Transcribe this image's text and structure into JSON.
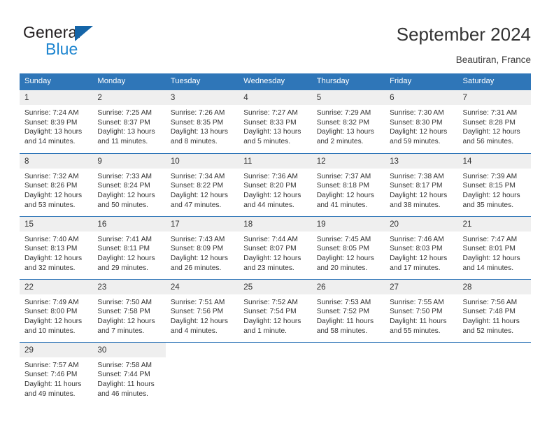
{
  "brand": {
    "word_one": "General",
    "word_two": "Blue",
    "triangle_color": "#1565a8",
    "blue_color": "#1f86d0"
  },
  "header": {
    "title": "September 2024",
    "location": "Beautiran, France"
  },
  "theme": {
    "header_blue": "#2f76b8",
    "daynum_band": "#efefef",
    "text": "#333333"
  },
  "labels": {
    "sunrise_prefix": "Sunrise:",
    "sunset_prefix": "Sunset:",
    "daylight_prefix": "Daylight:"
  },
  "columns": [
    "Sunday",
    "Monday",
    "Tuesday",
    "Wednesday",
    "Thursday",
    "Friday",
    "Saturday"
  ],
  "weeks": [
    [
      {
        "day": "1",
        "sunrise": "Sunrise: 7:24 AM",
        "sunset": "Sunset: 8:39 PM",
        "daylight_l1": "Daylight: 13 hours",
        "daylight_l2": "and 14 minutes."
      },
      {
        "day": "2",
        "sunrise": "Sunrise: 7:25 AM",
        "sunset": "Sunset: 8:37 PM",
        "daylight_l1": "Daylight: 13 hours",
        "daylight_l2": "and 11 minutes."
      },
      {
        "day": "3",
        "sunrise": "Sunrise: 7:26 AM",
        "sunset": "Sunset: 8:35 PM",
        "daylight_l1": "Daylight: 13 hours",
        "daylight_l2": "and 8 minutes."
      },
      {
        "day": "4",
        "sunrise": "Sunrise: 7:27 AM",
        "sunset": "Sunset: 8:33 PM",
        "daylight_l1": "Daylight: 13 hours",
        "daylight_l2": "and 5 minutes."
      },
      {
        "day": "5",
        "sunrise": "Sunrise: 7:29 AM",
        "sunset": "Sunset: 8:32 PM",
        "daylight_l1": "Daylight: 13 hours",
        "daylight_l2": "and 2 minutes."
      },
      {
        "day": "6",
        "sunrise": "Sunrise: 7:30 AM",
        "sunset": "Sunset: 8:30 PM",
        "daylight_l1": "Daylight: 12 hours",
        "daylight_l2": "and 59 minutes."
      },
      {
        "day": "7",
        "sunrise": "Sunrise: 7:31 AM",
        "sunset": "Sunset: 8:28 PM",
        "daylight_l1": "Daylight: 12 hours",
        "daylight_l2": "and 56 minutes."
      }
    ],
    [
      {
        "day": "8",
        "sunrise": "Sunrise: 7:32 AM",
        "sunset": "Sunset: 8:26 PM",
        "daylight_l1": "Daylight: 12 hours",
        "daylight_l2": "and 53 minutes."
      },
      {
        "day": "9",
        "sunrise": "Sunrise: 7:33 AM",
        "sunset": "Sunset: 8:24 PM",
        "daylight_l1": "Daylight: 12 hours",
        "daylight_l2": "and 50 minutes."
      },
      {
        "day": "10",
        "sunrise": "Sunrise: 7:34 AM",
        "sunset": "Sunset: 8:22 PM",
        "daylight_l1": "Daylight: 12 hours",
        "daylight_l2": "and 47 minutes."
      },
      {
        "day": "11",
        "sunrise": "Sunrise: 7:36 AM",
        "sunset": "Sunset: 8:20 PM",
        "daylight_l1": "Daylight: 12 hours",
        "daylight_l2": "and 44 minutes."
      },
      {
        "day": "12",
        "sunrise": "Sunrise: 7:37 AM",
        "sunset": "Sunset: 8:18 PM",
        "daylight_l1": "Daylight: 12 hours",
        "daylight_l2": "and 41 minutes."
      },
      {
        "day": "13",
        "sunrise": "Sunrise: 7:38 AM",
        "sunset": "Sunset: 8:17 PM",
        "daylight_l1": "Daylight: 12 hours",
        "daylight_l2": "and 38 minutes."
      },
      {
        "day": "14",
        "sunrise": "Sunrise: 7:39 AM",
        "sunset": "Sunset: 8:15 PM",
        "daylight_l1": "Daylight: 12 hours",
        "daylight_l2": "and 35 minutes."
      }
    ],
    [
      {
        "day": "15",
        "sunrise": "Sunrise: 7:40 AM",
        "sunset": "Sunset: 8:13 PM",
        "daylight_l1": "Daylight: 12 hours",
        "daylight_l2": "and 32 minutes."
      },
      {
        "day": "16",
        "sunrise": "Sunrise: 7:41 AM",
        "sunset": "Sunset: 8:11 PM",
        "daylight_l1": "Daylight: 12 hours",
        "daylight_l2": "and 29 minutes."
      },
      {
        "day": "17",
        "sunrise": "Sunrise: 7:43 AM",
        "sunset": "Sunset: 8:09 PM",
        "daylight_l1": "Daylight: 12 hours",
        "daylight_l2": "and 26 minutes."
      },
      {
        "day": "18",
        "sunrise": "Sunrise: 7:44 AM",
        "sunset": "Sunset: 8:07 PM",
        "daylight_l1": "Daylight: 12 hours",
        "daylight_l2": "and 23 minutes."
      },
      {
        "day": "19",
        "sunrise": "Sunrise: 7:45 AM",
        "sunset": "Sunset: 8:05 PM",
        "daylight_l1": "Daylight: 12 hours",
        "daylight_l2": "and 20 minutes."
      },
      {
        "day": "20",
        "sunrise": "Sunrise: 7:46 AM",
        "sunset": "Sunset: 8:03 PM",
        "daylight_l1": "Daylight: 12 hours",
        "daylight_l2": "and 17 minutes."
      },
      {
        "day": "21",
        "sunrise": "Sunrise: 7:47 AM",
        "sunset": "Sunset: 8:01 PM",
        "daylight_l1": "Daylight: 12 hours",
        "daylight_l2": "and 14 minutes."
      }
    ],
    [
      {
        "day": "22",
        "sunrise": "Sunrise: 7:49 AM",
        "sunset": "Sunset: 8:00 PM",
        "daylight_l1": "Daylight: 12 hours",
        "daylight_l2": "and 10 minutes."
      },
      {
        "day": "23",
        "sunrise": "Sunrise: 7:50 AM",
        "sunset": "Sunset: 7:58 PM",
        "daylight_l1": "Daylight: 12 hours",
        "daylight_l2": "and 7 minutes."
      },
      {
        "day": "24",
        "sunrise": "Sunrise: 7:51 AM",
        "sunset": "Sunset: 7:56 PM",
        "daylight_l1": "Daylight: 12 hours",
        "daylight_l2": "and 4 minutes."
      },
      {
        "day": "25",
        "sunrise": "Sunrise: 7:52 AM",
        "sunset": "Sunset: 7:54 PM",
        "daylight_l1": "Daylight: 12 hours",
        "daylight_l2": "and 1 minute."
      },
      {
        "day": "26",
        "sunrise": "Sunrise: 7:53 AM",
        "sunset": "Sunset: 7:52 PM",
        "daylight_l1": "Daylight: 11 hours",
        "daylight_l2": "and 58 minutes."
      },
      {
        "day": "27",
        "sunrise": "Sunrise: 7:55 AM",
        "sunset": "Sunset: 7:50 PM",
        "daylight_l1": "Daylight: 11 hours",
        "daylight_l2": "and 55 minutes."
      },
      {
        "day": "28",
        "sunrise": "Sunrise: 7:56 AM",
        "sunset": "Sunset: 7:48 PM",
        "daylight_l1": "Daylight: 11 hours",
        "daylight_l2": "and 52 minutes."
      }
    ],
    [
      {
        "day": "29",
        "sunrise": "Sunrise: 7:57 AM",
        "sunset": "Sunset: 7:46 PM",
        "daylight_l1": "Daylight: 11 hours",
        "daylight_l2": "and 49 minutes."
      },
      {
        "day": "30",
        "sunrise": "Sunrise: 7:58 AM",
        "sunset": "Sunset: 7:44 PM",
        "daylight_l1": "Daylight: 11 hours",
        "daylight_l2": "and 46 minutes."
      },
      {
        "day": "",
        "sunrise": "",
        "sunset": "",
        "daylight_l1": "",
        "daylight_l2": ""
      },
      {
        "day": "",
        "sunrise": "",
        "sunset": "",
        "daylight_l1": "",
        "daylight_l2": ""
      },
      {
        "day": "",
        "sunrise": "",
        "sunset": "",
        "daylight_l1": "",
        "daylight_l2": ""
      },
      {
        "day": "",
        "sunrise": "",
        "sunset": "",
        "daylight_l1": "",
        "daylight_l2": ""
      },
      {
        "day": "",
        "sunrise": "",
        "sunset": "",
        "daylight_l1": "",
        "daylight_l2": ""
      }
    ]
  ]
}
